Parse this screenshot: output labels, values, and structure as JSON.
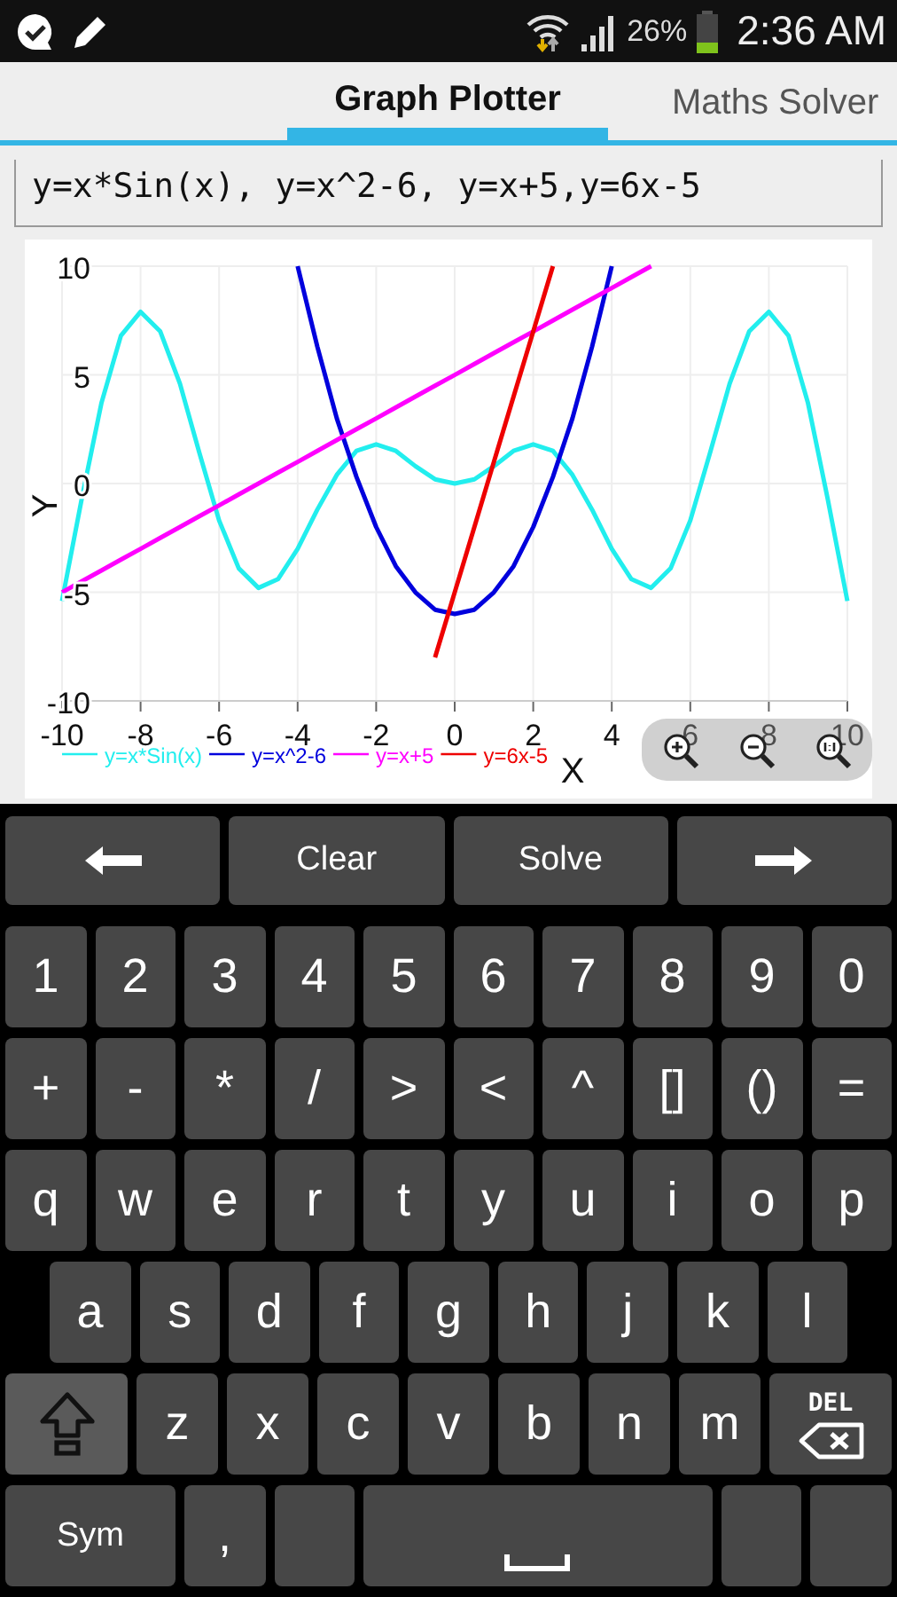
{
  "status_bar": {
    "battery": "26%",
    "time": "2:36 AM"
  },
  "tabs": [
    {
      "label": "Graph Plotter",
      "selected": true
    },
    {
      "label": "Maths Solver",
      "selected": false
    }
  ],
  "equation_field": {
    "value": "y=x*Sin(x), y=x^2-6, y=x+5,y=6x-5"
  },
  "graph": {
    "chart_data": {
      "type": "line",
      "xlabel": "X",
      "ylabel": "Y",
      "xlim": [
        -10,
        10
      ],
      "ylim": [
        -10,
        10
      ],
      "xticks": [
        {
          "value": -10,
          "label": "-10"
        },
        {
          "value": -8,
          "label": "-8"
        },
        {
          "value": -6,
          "label": "-6"
        },
        {
          "value": -4,
          "label": "-4"
        },
        {
          "value": -2,
          "label": "-2"
        },
        {
          "value": 0,
          "label": "0"
        },
        {
          "value": 2,
          "label": "2"
        },
        {
          "value": 4,
          "label": "4"
        },
        {
          "value": 6,
          "label": "6"
        },
        {
          "value": 8,
          "label": "8"
        },
        {
          "value": 10,
          "label": "10"
        }
      ],
      "yticks": [
        {
          "value": -10,
          "label": "-10"
        },
        {
          "value": -5,
          "label": "-5"
        },
        {
          "value": 0,
          "label": "0"
        },
        {
          "value": 5,
          "label": "5"
        },
        {
          "value": 10,
          "label": "10"
        }
      ],
      "x": [
        -10,
        -9.5,
        -9,
        -8.5,
        -8,
        -7.5,
        -7,
        -6.5,
        -6,
        -5.5,
        -5,
        -4.5,
        -4,
        -3.5,
        -3,
        -2.5,
        -2,
        -1.5,
        -1,
        -0.5,
        0,
        0.5,
        1,
        1.5,
        2,
        2.5,
        3,
        3.5,
        4,
        4.5,
        5,
        5.5,
        6,
        6.5,
        7,
        7.5,
        8,
        8.5,
        9,
        9.5,
        10
      ],
      "series": [
        {
          "name": "y=x*Sin(x)",
          "color": "#22eeee",
          "values": [
            -5.4,
            -0.7,
            3.7,
            6.8,
            7.9,
            7,
            4.6,
            1.4,
            -1.7,
            -3.9,
            -4.8,
            -4.4,
            -3,
            -1.2,
            0.4,
            1.5,
            1.8,
            1.5,
            0.8,
            0.2,
            0,
            0.2,
            0.8,
            1.5,
            1.8,
            1.5,
            0.4,
            -1.2,
            -3,
            -4.4,
            -4.8,
            -3.9,
            -1.7,
            1.4,
            4.6,
            7,
            7.9,
            6.8,
            3.7,
            -0.7,
            -5.4
          ]
        },
        {
          "name": "y=x^2-6",
          "color": "#0000dd",
          "values": [
            null,
            null,
            null,
            null,
            null,
            null,
            null,
            null,
            null,
            null,
            null,
            null,
            10,
            6.3,
            3,
            0.3,
            -2,
            -3.8,
            -5,
            -5.8,
            -6,
            -5.8,
            -5,
            -3.8,
            -2,
            0.3,
            3,
            6.3,
            10,
            null,
            null,
            null,
            null,
            null,
            null,
            null,
            null,
            null,
            null,
            null,
            null
          ]
        },
        {
          "name": "y=x+5",
          "color": "#ff00ff",
          "values": [
            -5,
            -4.5,
            -4,
            -3.5,
            -3,
            -2.5,
            -2,
            -1.5,
            -1,
            -0.5,
            0,
            0.5,
            1,
            1.5,
            2,
            2.5,
            3,
            3.5,
            4,
            4.5,
            5,
            5.5,
            6,
            6.5,
            7,
            7.5,
            8,
            8.5,
            9,
            9.5,
            10,
            null,
            null,
            null,
            null,
            null,
            null,
            null,
            null,
            null,
            null
          ]
        },
        {
          "name": "y=6x-5",
          "color": "#ee0000",
          "values": [
            null,
            null,
            null,
            null,
            null,
            null,
            null,
            null,
            null,
            null,
            null,
            null,
            null,
            null,
            null,
            null,
            null,
            null,
            null,
            -8,
            -5,
            -2,
            1,
            4,
            7,
            10,
            null,
            null,
            null,
            null,
            null,
            null,
            null,
            null,
            null,
            null,
            null,
            null,
            null,
            null,
            null
          ]
        }
      ],
      "grid": true,
      "legend": true
    }
  },
  "keyboard": {
    "rows": [
      {
        "keys": [
          {
            "kind": "arrow-left"
          },
          {
            "kind": "action",
            "label": "Clear"
          },
          {
            "kind": "action",
            "label": "Solve"
          },
          {
            "kind": "arrow-right"
          }
        ]
      },
      {
        "keys": [
          {
            "kind": "char",
            "label": "1"
          },
          {
            "kind": "char",
            "label": "2"
          },
          {
            "kind": "char",
            "label": "3"
          },
          {
            "kind": "char",
            "label": "4"
          },
          {
            "kind": "char",
            "label": "5"
          },
          {
            "kind": "char",
            "label": "6"
          },
          {
            "kind": "char",
            "label": "7"
          },
          {
            "kind": "char",
            "label": "8"
          },
          {
            "kind": "char",
            "label": "9"
          },
          {
            "kind": "char",
            "label": "0"
          }
        ]
      },
      {
        "keys": [
          {
            "kind": "char",
            "label": "+"
          },
          {
            "kind": "char",
            "label": "-"
          },
          {
            "kind": "char",
            "label": "*"
          },
          {
            "kind": "char",
            "label": "/"
          },
          {
            "kind": "char",
            "label": ">"
          },
          {
            "kind": "char",
            "label": "<"
          },
          {
            "kind": "char",
            "label": "^"
          },
          {
            "kind": "char",
            "label": "[]"
          },
          {
            "kind": "char",
            "label": "()"
          },
          {
            "kind": "char",
            "label": "="
          }
        ]
      },
      {
        "keys": [
          {
            "kind": "char",
            "label": "q"
          },
          {
            "kind": "char",
            "label": "w"
          },
          {
            "kind": "char",
            "label": "e"
          },
          {
            "kind": "char",
            "label": "r"
          },
          {
            "kind": "char",
            "label": "t"
          },
          {
            "kind": "char",
            "label": "y"
          },
          {
            "kind": "char",
            "label": "u"
          },
          {
            "kind": "char",
            "label": "i"
          },
          {
            "kind": "char",
            "label": "o"
          },
          {
            "kind": "char",
            "label": "p"
          }
        ]
      },
      {
        "keys": [
          {
            "kind": "char",
            "label": "a"
          },
          {
            "kind": "char",
            "label": "s"
          },
          {
            "kind": "char",
            "label": "d"
          },
          {
            "kind": "char",
            "label": "f"
          },
          {
            "kind": "char",
            "label": "g"
          },
          {
            "kind": "char",
            "label": "h"
          },
          {
            "kind": "char",
            "label": "j"
          },
          {
            "kind": "char",
            "label": "k"
          },
          {
            "kind": "char",
            "label": "l"
          }
        ]
      },
      {
        "keys": [
          {
            "kind": "shift"
          },
          {
            "kind": "char",
            "label": "z"
          },
          {
            "kind": "char",
            "label": "x"
          },
          {
            "kind": "char",
            "label": "c"
          },
          {
            "kind": "char",
            "label": "v"
          },
          {
            "kind": "char",
            "label": "b"
          },
          {
            "kind": "char",
            "label": "n"
          },
          {
            "kind": "char",
            "label": "m"
          },
          {
            "kind": "delete",
            "label": "DEL"
          }
        ]
      },
      {
        "keys": [
          {
            "kind": "sym",
            "label": "Sym"
          },
          {
            "kind": "char",
            "label": ","
          },
          {
            "kind": "blank"
          },
          {
            "kind": "space"
          },
          {
            "kind": "blank"
          },
          {
            "kind": "blank"
          }
        ]
      }
    ]
  }
}
